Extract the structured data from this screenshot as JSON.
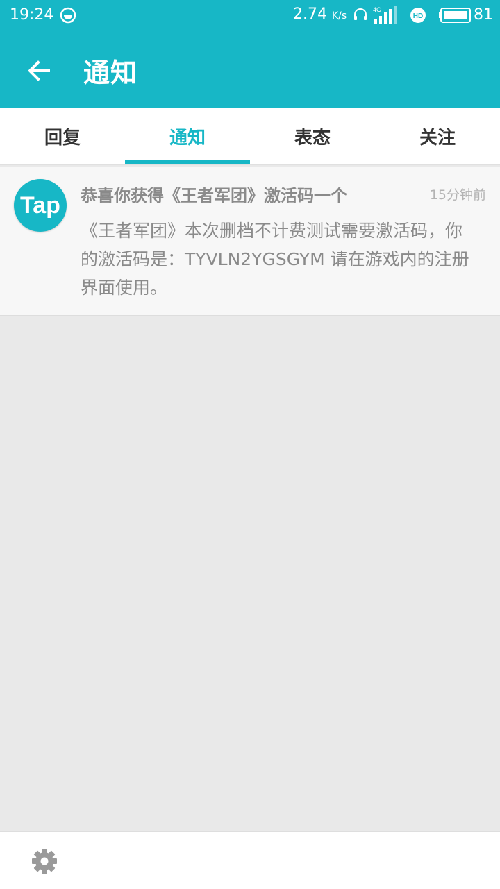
{
  "status_bar": {
    "time": "19:24",
    "net_speed_value": "2.74",
    "net_speed_unit": "K/s",
    "network_type": "4G",
    "battery_level": "81"
  },
  "header": {
    "back_icon": "arrow-left-icon",
    "title": "通知",
    "color": "#17b7c6"
  },
  "tabs": [
    {
      "label": "回复",
      "active": false
    },
    {
      "label": "通知",
      "active": true
    },
    {
      "label": "表态",
      "active": false
    },
    {
      "label": "关注",
      "active": false
    }
  ],
  "notifications": [
    {
      "avatar_text": "Tap",
      "title": "恭喜你获得《王者军团》激活码一个",
      "time": "15分钟前",
      "body": "《王者军团》本次删档不计费测试需要激活码，你的激活码是：TYVLN2YGSGYM 请在游戏内的注册界面使用。"
    }
  ],
  "bottom_bar": {
    "settings_icon": "gear-icon"
  }
}
